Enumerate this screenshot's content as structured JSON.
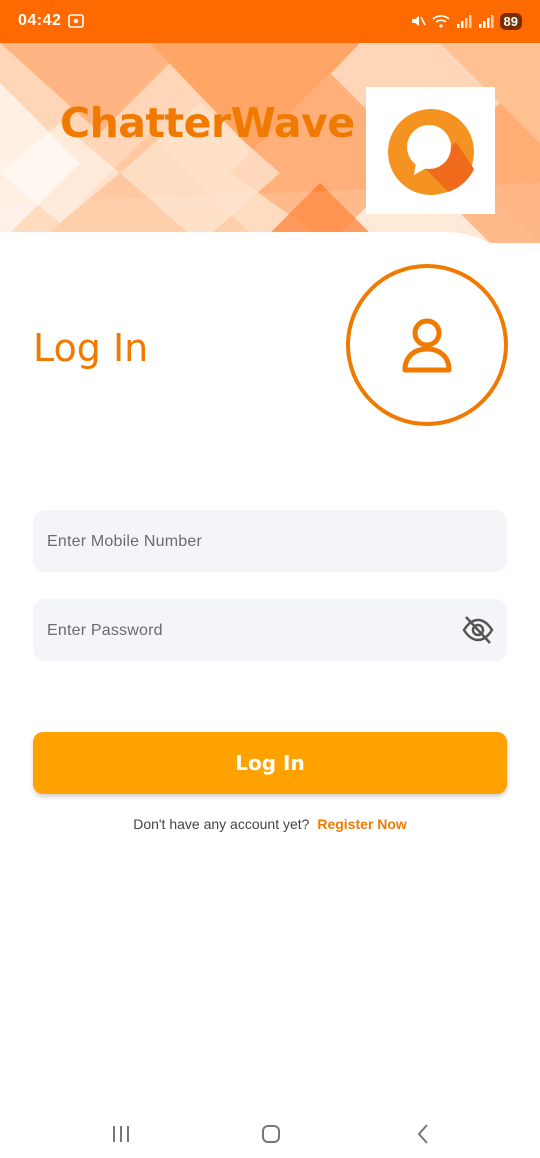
{
  "status": {
    "time": "04:42",
    "battery": "89"
  },
  "header": {
    "app_name": "ChatterWave",
    "logo": "chat-bubble-logo"
  },
  "main": {
    "title": "Log In",
    "avatar_icon": "user-icon"
  },
  "form": {
    "mobile_placeholder": "Enter Mobile Number",
    "password_placeholder": "Enter Password",
    "visibility_icon": "eye-off-icon",
    "submit_label": "Log In",
    "register_prompt": "Don't have any account yet?",
    "register_link": "Register Now"
  },
  "nav": {
    "recents": "recents-icon",
    "home": "home-icon",
    "back": "back-icon"
  },
  "colors": {
    "accent": "#f07a00",
    "status_bar": "#ff6a00",
    "button": "#ffa200",
    "field_bg": "#f4f5f9"
  }
}
